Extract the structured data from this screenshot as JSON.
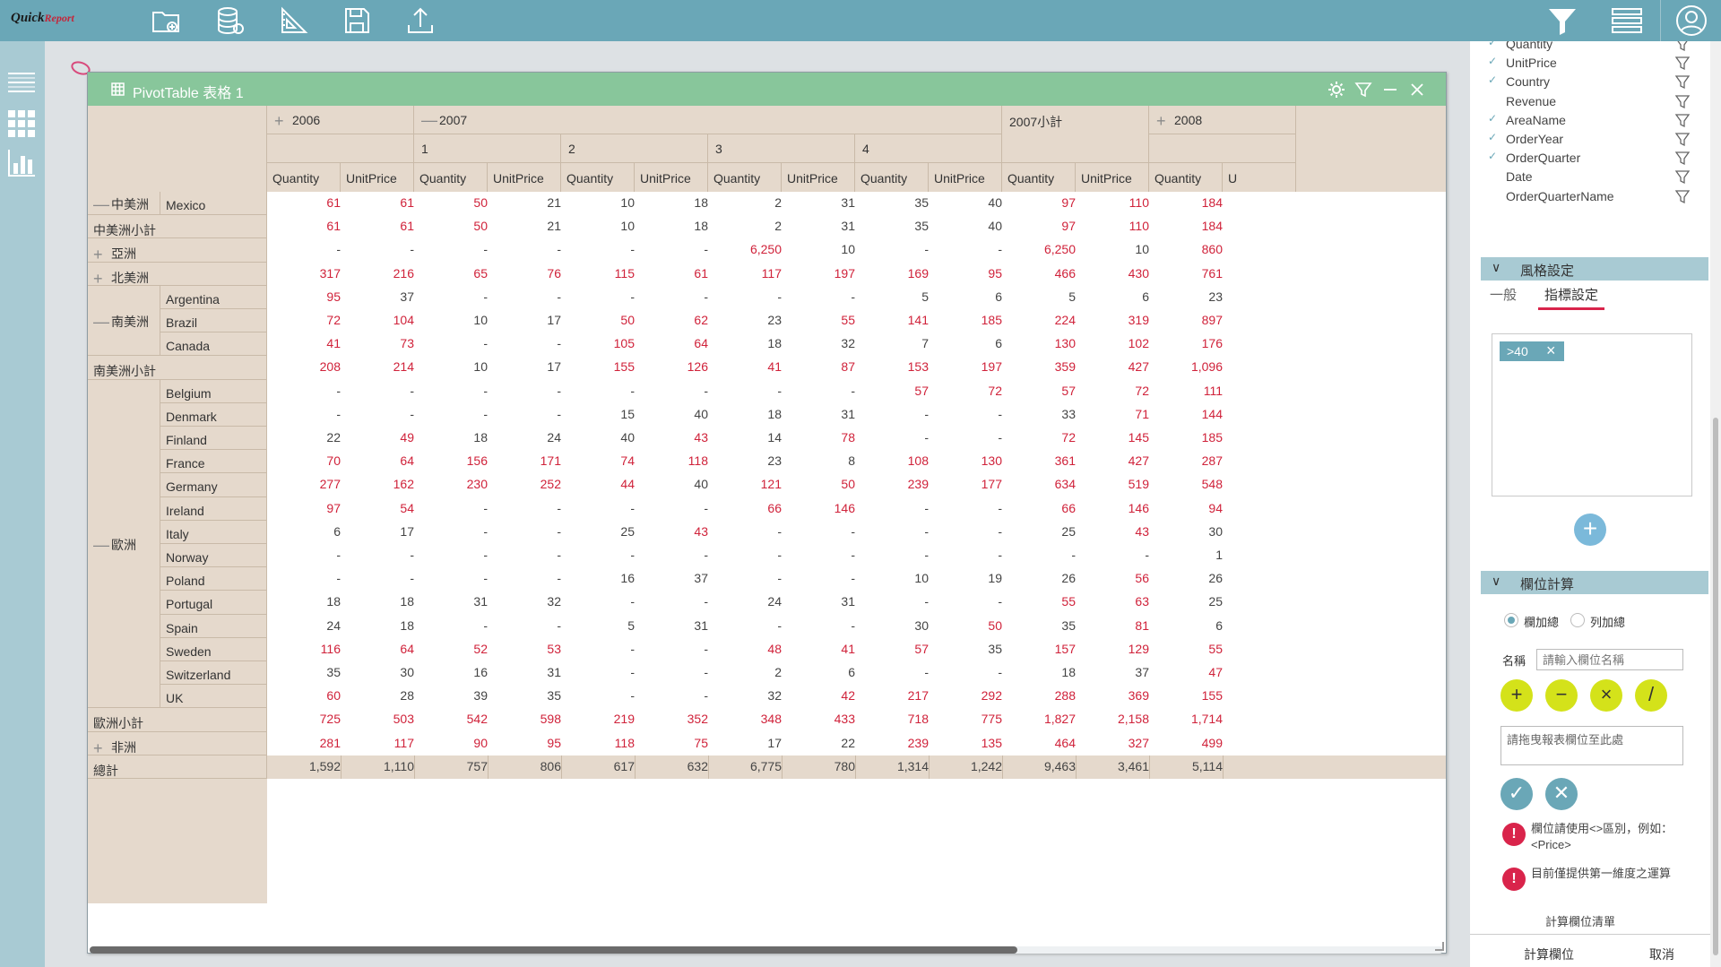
{
  "app": {
    "logo_main": "Quick",
    "logo_sub": "Report"
  },
  "toolbar": {
    "icons": [
      "open-folder-icon",
      "database-icon",
      "ruler-icon",
      "save-icon",
      "upload-icon"
    ],
    "right_icons": [
      "filter-icon",
      "list-icon",
      "user-icon"
    ]
  },
  "leftbar": {
    "icons": [
      "menu-icon",
      "grid-icon",
      "chart-icon"
    ]
  },
  "window": {
    "title": "PivotTable 表格 1"
  },
  "pivot": {
    "years": [
      {
        "label": "2006",
        "expander": "plus"
      },
      {
        "label": "2007",
        "expander": "minus"
      },
      {
        "label": "2007小計",
        "expander": ""
      },
      {
        "label": "2008",
        "expander": "plus"
      }
    ],
    "quarters": [
      "1",
      "2",
      "3",
      "4"
    ],
    "measures": [
      "Quantity",
      "UnitPrice",
      "Quantity",
      "UnitPrice",
      "Quantity",
      "UnitPrice",
      "Quantity",
      "UnitPrice",
      "Quantity",
      "UnitPrice",
      "Quantity",
      "UnitPrice",
      "Quantity",
      "U"
    ],
    "highlight_rule": ">40",
    "rows": [
      {
        "group": "中美洲",
        "group_exp": "minus",
        "label": "Mexico",
        "values": [
          "61",
          "61",
          "50",
          "21",
          "10",
          "18",
          "2",
          "31",
          "35",
          "40",
          "97",
          "110",
          "184"
        ]
      },
      {
        "label_full": "中美洲小計",
        "values": [
          "61",
          "61",
          "50",
          "21",
          "10",
          "18",
          "2",
          "31",
          "35",
          "40",
          "97",
          "110",
          "184"
        ]
      },
      {
        "label_full": "亞洲",
        "exp": "plus",
        "values": [
          "-",
          "-",
          "-",
          "-",
          "-",
          "-",
          "6,250",
          "10",
          "-",
          "-",
          "6,250",
          "10",
          "860"
        ]
      },
      {
        "label_full": "北美洲",
        "exp": "plus",
        "values": [
          "317",
          "216",
          "65",
          "76",
          "115",
          "61",
          "117",
          "197",
          "169",
          "95",
          "466",
          "430",
          "761"
        ]
      },
      {
        "label": "Argentina",
        "values": [
          "95",
          "37",
          "-",
          "-",
          "-",
          "-",
          "-",
          "-",
          "5",
          "6",
          "5",
          "6",
          "23"
        ]
      },
      {
        "group": "南美洲",
        "group_exp": "minus",
        "label": "Brazil",
        "values": [
          "72",
          "104",
          "10",
          "17",
          "50",
          "62",
          "23",
          "55",
          "141",
          "185",
          "224",
          "319",
          "897"
        ]
      },
      {
        "label": "Canada",
        "values": [
          "41",
          "73",
          "-",
          "-",
          "105",
          "64",
          "18",
          "32",
          "7",
          "6",
          "130",
          "102",
          "176"
        ]
      },
      {
        "label_full": "南美洲小計",
        "values": [
          "208",
          "214",
          "10",
          "17",
          "155",
          "126",
          "41",
          "87",
          "153",
          "197",
          "359",
          "427",
          "1,096"
        ]
      },
      {
        "label": "Belgium",
        "values": [
          "-",
          "-",
          "-",
          "-",
          "-",
          "-",
          "-",
          "-",
          "57",
          "72",
          "57",
          "72",
          "111"
        ]
      },
      {
        "label": "Denmark",
        "values": [
          "-",
          "-",
          "-",
          "-",
          "15",
          "40",
          "18",
          "31",
          "-",
          "-",
          "33",
          "71",
          "144"
        ]
      },
      {
        "label": "Finland",
        "values": [
          "22",
          "49",
          "18",
          "24",
          "40",
          "43",
          "14",
          "78",
          "-",
          "-",
          "72",
          "145",
          "185"
        ]
      },
      {
        "label": "France",
        "values": [
          "70",
          "64",
          "156",
          "171",
          "74",
          "118",
          "23",
          "8",
          "108",
          "130",
          "361",
          "427",
          "287"
        ]
      },
      {
        "label": "Germany",
        "values": [
          "277",
          "162",
          "230",
          "252",
          "44",
          "40",
          "121",
          "50",
          "239",
          "177",
          "634",
          "519",
          "548"
        ]
      },
      {
        "label": "Ireland",
        "values": [
          "97",
          "54",
          "-",
          "-",
          "-",
          "-",
          "66",
          "146",
          "-",
          "-",
          "66",
          "146",
          "94"
        ]
      },
      {
        "label": "Italy",
        "values": [
          "6",
          "17",
          "-",
          "-",
          "25",
          "43",
          "-",
          "-",
          "-",
          "-",
          "25",
          "43",
          "30"
        ]
      },
      {
        "group": "歐洲",
        "group_exp": "minus",
        "label": "Norway",
        "values": [
          "-",
          "-",
          "-",
          "-",
          "-",
          "-",
          "-",
          "-",
          "-",
          "-",
          "-",
          "-",
          "1"
        ]
      },
      {
        "label": "Poland",
        "values": [
          "-",
          "-",
          "-",
          "-",
          "16",
          "37",
          "-",
          "-",
          "10",
          "19",
          "26",
          "56",
          "26"
        ]
      },
      {
        "label": "Portugal",
        "values": [
          "18",
          "18",
          "31",
          "32",
          "-",
          "-",
          "24",
          "31",
          "-",
          "-",
          "55",
          "63",
          "25"
        ]
      },
      {
        "label": "Spain",
        "values": [
          "24",
          "18",
          "-",
          "-",
          "5",
          "31",
          "-",
          "-",
          "30",
          "50",
          "35",
          "81",
          "6"
        ]
      },
      {
        "label": "Sweden",
        "values": [
          "116",
          "64",
          "52",
          "53",
          "-",
          "-",
          "48",
          "41",
          "57",
          "35",
          "157",
          "129",
          "55"
        ]
      },
      {
        "label": "Switzerland",
        "values": [
          "35",
          "30",
          "16",
          "31",
          "-",
          "-",
          "2",
          "6",
          "-",
          "-",
          "18",
          "37",
          "47"
        ]
      },
      {
        "label": "UK",
        "values": [
          "60",
          "28",
          "39",
          "35",
          "-",
          "-",
          "32",
          "42",
          "217",
          "292",
          "288",
          "369",
          "155"
        ]
      },
      {
        "label_full": "歐洲小計",
        "values": [
          "725",
          "503",
          "542",
          "598",
          "219",
          "352",
          "348",
          "433",
          "718",
          "775",
          "1,827",
          "2,158",
          "1,714"
        ]
      },
      {
        "label_full": "非洲",
        "exp": "plus",
        "values": [
          "281",
          "117",
          "90",
          "95",
          "118",
          "75",
          "17",
          "22",
          "239",
          "135",
          "464",
          "327",
          "499"
        ]
      }
    ],
    "total": {
      "label": "總計",
      "values": [
        "1,592",
        "1,110",
        "757",
        "806",
        "617",
        "632",
        "6,775",
        "780",
        "1,314",
        "1,242",
        "9,463",
        "3,461",
        "5,114"
      ]
    }
  },
  "fields": [
    {
      "name": "Quantity",
      "checked": true
    },
    {
      "name": "UnitPrice",
      "checked": true
    },
    {
      "name": "Country",
      "checked": true
    },
    {
      "name": "Revenue",
      "checked": false
    },
    {
      "name": "AreaName",
      "checked": true
    },
    {
      "name": "OrderYear",
      "checked": true
    },
    {
      "name": "OrderQuarter",
      "checked": true
    },
    {
      "name": "Date",
      "checked": false
    },
    {
      "name": "OrderQuarterName",
      "checked": false
    }
  ],
  "style_section": {
    "title": "風格設定",
    "tab_general": "一般",
    "tab_indicator": "指標設定",
    "chip": ">40"
  },
  "calc_section": {
    "title": "欄位計算",
    "radio_col": "欄加總",
    "radio_row": "列加總",
    "name_label": "名稱",
    "name_placeholder": "請輸入欄位名稱",
    "ops": [
      "+",
      "−",
      "×",
      "/"
    ],
    "drop_placeholder": "請拖曳報表欄位至此處",
    "note1": "欄位請使用<>區別，例如：<Price>",
    "note2": "目前僅提供第一維度之運算",
    "list_link": "計算欄位清單",
    "footer_calc": "計算欄位",
    "footer_cancel": "取消"
  },
  "colors": {
    "topbar": "#6aa7b7",
    "header": "#88c69b",
    "highlight": "#d0223a",
    "op_buttons": "#d4e21a",
    "confirm_buttons": "#6aa7b7"
  }
}
